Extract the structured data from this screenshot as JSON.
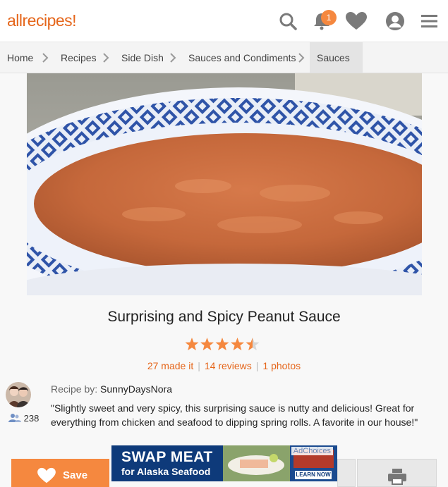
{
  "header": {
    "logo_text": "allrecipes",
    "logo_mark": "!",
    "notification_count": "1",
    "icons": [
      "search-icon",
      "bell-icon",
      "heart-icon",
      "profile-icon",
      "menu-icon"
    ],
    "accent_color": "#f5883f"
  },
  "breadcrumb": {
    "items": [
      "Home",
      "Recipes",
      "Side Dish",
      "Sauces and Condiments",
      "Sauces"
    ]
  },
  "recipe": {
    "title": "Surprising and Spicy Peanut Sauce",
    "rating": 4.5,
    "rating_max": 5,
    "made_it": "27 made it",
    "reviews": "14 reviews",
    "photos": "1 photos",
    "recipe_by_label": "Recipe by:",
    "author": "SunnyDaysNora",
    "followers": "238",
    "description": "\"Slightly sweet and very spicy, this surprising sauce is nutty and delicious! Great for everything from chicken and seafood to dipping spring rolls. A favorite in our house!\""
  },
  "actions": {
    "save_label": "Save"
  },
  "ad": {
    "headline": "SWAP MEAT",
    "subline": "for Alaska Seafood",
    "choices": "AdChoices",
    "cta": "LEARN NOW"
  }
}
